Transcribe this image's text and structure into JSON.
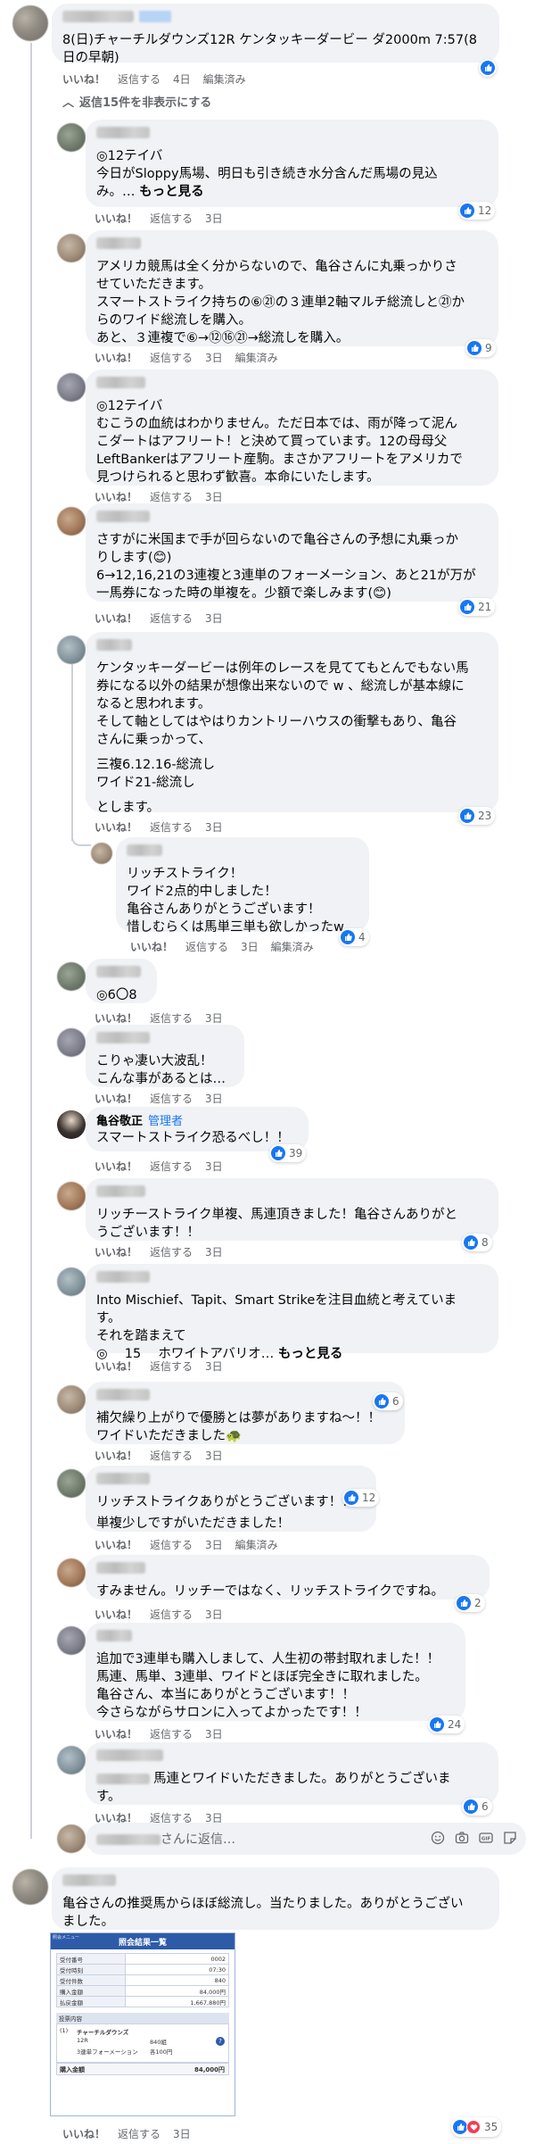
{
  "top_comment": {
    "lines": [
      "8(日)チャーチルダウンズ12R ケンタッキーダービー ダ2000m 7:57(8",
      "日の早朝)"
    ],
    "actions": {
      "like": "いいね！",
      "reply": "返信する",
      "time": "4日",
      "edited": "編集済み"
    },
    "hide_replies": "返信15件を非表示にする"
  },
  "replies": [
    {
      "lines": [
        "◎12テイバ",
        "",
        "今日がSloppy馬場、明日も引き続き水分含んだ馬場の見込"
      ],
      "more_prefix": "み。… ",
      "more": "もっと見る",
      "like": "いいね！",
      "reply": "返信する",
      "time": "3日",
      "reactions": "12"
    },
    {
      "lines": [
        "アメリカ競馬は全く分からないので、亀谷さんに丸乗っかりさ",
        "せていただきます。",
        "スマートストライク持ちの⑥㉑の３連単2軸マルチ総流しと㉑か",
        "らのワイド総流しを購入。",
        "あと、３連複で⑥→⑫⑯㉑→総流しを購入。"
      ],
      "like": "いいね！",
      "reply": "返信する",
      "time": "3日",
      "edited": "編集済み",
      "reactions": "9"
    },
    {
      "lines": [
        "◎12テイバ",
        "むこうの血統はわかりません。ただ日本では、雨が降って泥ん",
        "こダートはアフリート！と決めて買っています。12の母母父",
        "LeftBankerはアフリート産駒。まさかアフリートをアメリカで",
        "見つけられると思わず歓喜。本命にいたします。"
      ],
      "like": "いいね！",
      "reply": "返信する",
      "time": "3日"
    },
    {
      "lines": [
        "さすがに米国まで手が回らないので亀谷さんの予想に丸乗っか",
        "りします(😊)",
        "6→12,16,21の3連複と3連単のフォーメーション、あと21が万が",
        "一馬券になった時の単複を。少額で楽しみます(😊)"
      ],
      "like": "いいね！",
      "reply": "返信する",
      "time": "3日",
      "reactions": "21"
    },
    {
      "lines": [
        "ケンタッキーダービーは例年のレースを見ててもとんでもない馬",
        "券になる以外の結果が想像出来ないので w 、総流しが基本線に",
        "なると思われます。",
        "そして軸としてはやはりカントリーハウスの衝撃もあり、亀谷",
        "さんに乗っかって、",
        "",
        "三複6.12.16-総流し",
        "ワイド21-総流し",
        "",
        "とします。"
      ],
      "like": "いいね！",
      "reply": "返信する",
      "time": "3日",
      "reactions": "23"
    },
    {
      "lines": [
        "リッチストライク！",
        "ワイド2点的中しました！",
        "亀谷さんありがとうございます！",
        "惜しむらくは馬単三単も欲しかったw"
      ],
      "like": "いいね！",
      "reply": "返信する",
      "time": "3日",
      "edited": "編集済み",
      "reactions": "4"
    },
    {
      "lines": [
        "◎6〇8"
      ],
      "like": "いいね！",
      "reply": "返信する",
      "time": "3日"
    },
    {
      "lines": [
        "こりゃ凄い大波乱！",
        "こんな事があるとは…"
      ],
      "like": "いいね！",
      "reply": "返信する",
      "time": "3日"
    },
    {
      "author": "亀谷敬正",
      "badge": "管理者",
      "lines": [
        "スマートストライク恐るべし！！"
      ],
      "like": "いいね！",
      "reply": "返信する",
      "time": "3日",
      "reactions": "39"
    },
    {
      "lines": [
        "リッチーストライク単複、馬連頂きました！亀谷さんありがと",
        "うございます！！"
      ],
      "like": "いいね！",
      "reply": "返信する",
      "time": "3日",
      "reactions": "8"
    },
    {
      "lines": [
        "Into Mischief、Tapit、Smart Strikeを注目血統と考えていま",
        "す。",
        "それを踏まえて"
      ],
      "more_prefix": "◎　 15　 ホワイトアバリオ… ",
      "more": "もっと見る",
      "like": "いいね！",
      "reply": "返信する",
      "time": "3日"
    },
    {
      "lines": [
        "補欠繰り上がりで優勝とは夢がありますね〜！！",
        "ワイドいただきました🐢"
      ],
      "like": "いいね！",
      "reply": "返信する",
      "time": "3日",
      "reactions": "6"
    },
    {
      "lines": [
        "リッチストライクありがとうございます！！",
        "単複少しですがいただきました！"
      ],
      "like": "いいね！",
      "reply": "返信する",
      "time": "3日",
      "edited": "編集済み",
      "reactions": "12"
    },
    {
      "lines": [
        "すみません。リッチーではなく、リッチストライクですね。"
      ],
      "like": "いいね！",
      "reply": "返信する",
      "time": "3日",
      "reactions": "2"
    },
    {
      "lines": [
        "追加で3連単も購入しまして、人生初の帯封取れました！！",
        "馬連、馬単、3連単、ワイドとほぼ完全きに取れました。",
        "亀谷さん、本当にありがとうございます！！",
        "今さらながらサロンに入ってよかったです！！"
      ],
      "like": "いいね！",
      "reply": "返信する",
      "time": "3日",
      "reactions": "24"
    },
    {
      "lines": [
        "馬連とワイドいただきました。ありがとうございま",
        "す。"
      ],
      "like": "いいね！",
      "reply": "返信する",
      "time": "3日",
      "reactions": "6"
    }
  ],
  "reply_box": {
    "suffix": "さんに返信…"
  },
  "bottom_comment": {
    "lines": [
      "亀谷さんの推奨馬からほぼ総流し。当たりました。ありがとうござい",
      "ました。"
    ],
    "like": "いいね！",
    "reply": "返信する",
    "time": "3日",
    "reactions": "35"
  },
  "ticket": {
    "header_mini": "照会メニュー",
    "title": "照会結果一覧",
    "rows": [
      {
        "k": "受付番号",
        "v": "0002"
      },
      {
        "k": "受付時刻",
        "v": "07:30"
      },
      {
        "k": "受付件数",
        "v": "840"
      },
      {
        "k": "購入金額",
        "v": "84,000円"
      },
      {
        "k": "払戻金額",
        "v": "1,667,880円"
      }
    ],
    "section": "投票内容",
    "race_num": "(1)",
    "race_name": "チャーチルダウンズ",
    "race_r": "12R",
    "bet_type": "3連単フォーメーション",
    "count": "840組",
    "unit": "各100円",
    "total_label": "購入金額",
    "total": "84,000円"
  }
}
